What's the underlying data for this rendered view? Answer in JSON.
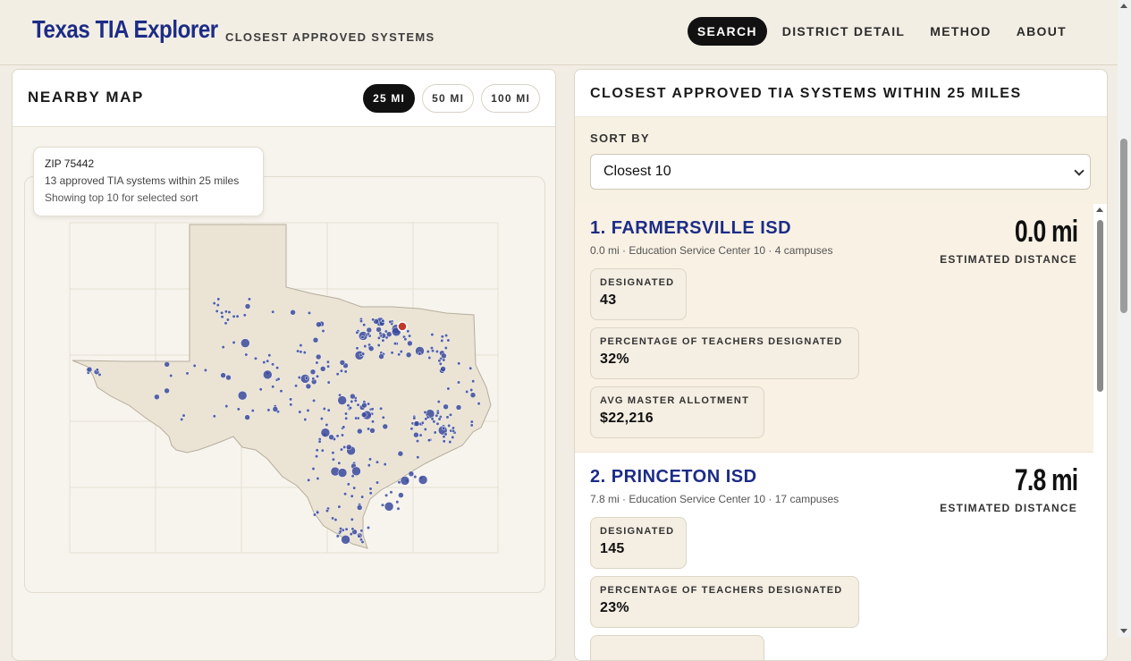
{
  "header": {
    "brand": "Texas TIA Explorer",
    "subtitle": "CLOSEST APPROVED SYSTEMS",
    "nav": [
      {
        "label": "SEARCH",
        "active": true
      },
      {
        "label": "DISTRICT DETAIL",
        "active": false
      },
      {
        "label": "METHOD",
        "active": false
      },
      {
        "label": "ABOUT",
        "active": false
      }
    ]
  },
  "map_panel": {
    "title": "NEARBY MAP",
    "radius_options": [
      "25 MI",
      "50 MI",
      "100 MI"
    ],
    "selected_radius": "25 MI",
    "tooltip": {
      "line1": "ZIP 75442",
      "line2": "13 approved TIA systems within 25 miles",
      "line3": "Showing top 10 for selected sort"
    },
    "colors": {
      "point": "#3a4a9c",
      "selected": "#c0392b",
      "land": "#ebe4d5"
    }
  },
  "results_panel": {
    "title": "CLOSEST APPROVED TIA SYSTEMS WITHIN 25 MILES",
    "sort_label": "SORT BY",
    "sort_value": "Closest 10",
    "results": [
      {
        "name": "1. FARMERSVILLE ISD",
        "meta": "0.0 mi · Education Service Center 10 · 4 campuses",
        "distance": "0.0 mi",
        "distance_label": "ESTIMATED DISTANCE",
        "stats": [
          {
            "label": "DESIGNATED",
            "value": "43"
          },
          {
            "label": "PERCENTAGE OF TEACHERS DESIGNATED",
            "value": "32%"
          },
          {
            "label": "AVG MASTER ALLOTMENT",
            "value": "$22,216"
          }
        ]
      },
      {
        "name": "2. PRINCETON ISD",
        "meta": "7.8 mi · Education Service Center 10 · 17 campuses",
        "distance": "7.8 mi",
        "distance_label": "ESTIMATED DISTANCE",
        "stats": [
          {
            "label": "DESIGNATED",
            "value": "145"
          },
          {
            "label": "PERCENTAGE OF TEACHERS DESIGNATED",
            "value": "23%"
          }
        ]
      }
    ]
  }
}
